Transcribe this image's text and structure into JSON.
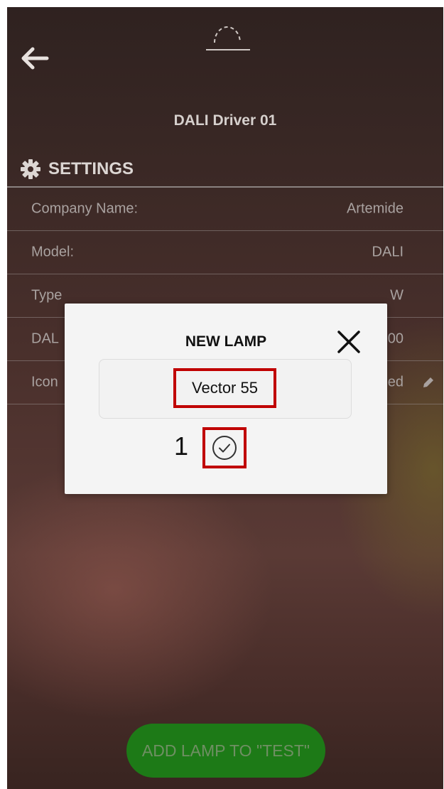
{
  "header": {
    "device_title": "DALI Driver 01",
    "back_icon": "arrow-left-icon",
    "top_icon": "lamp-arc-icon"
  },
  "settings": {
    "title": "SETTINGS",
    "icon": "gear-icon",
    "rows": [
      {
        "label": "Company Name:",
        "value": "Artemide"
      },
      {
        "label": "Model:",
        "value": "DALI"
      },
      {
        "label": "Type",
        "value": "W"
      },
      {
        "label": "DAL",
        "value": "00"
      },
      {
        "label": "Icon",
        "value": "ed",
        "edit_icon": "pencil-icon"
      }
    ]
  },
  "dialog": {
    "title": "NEW LAMP",
    "close_icon": "close-icon",
    "name_value": "Vector 55",
    "annotation": "1",
    "confirm_icon": "check-circle-icon"
  },
  "footer": {
    "add_button_label": "ADD LAMP TO \"TEST\""
  },
  "colors": {
    "button_green": "#1d7a17",
    "highlight_red": "#c00000"
  }
}
